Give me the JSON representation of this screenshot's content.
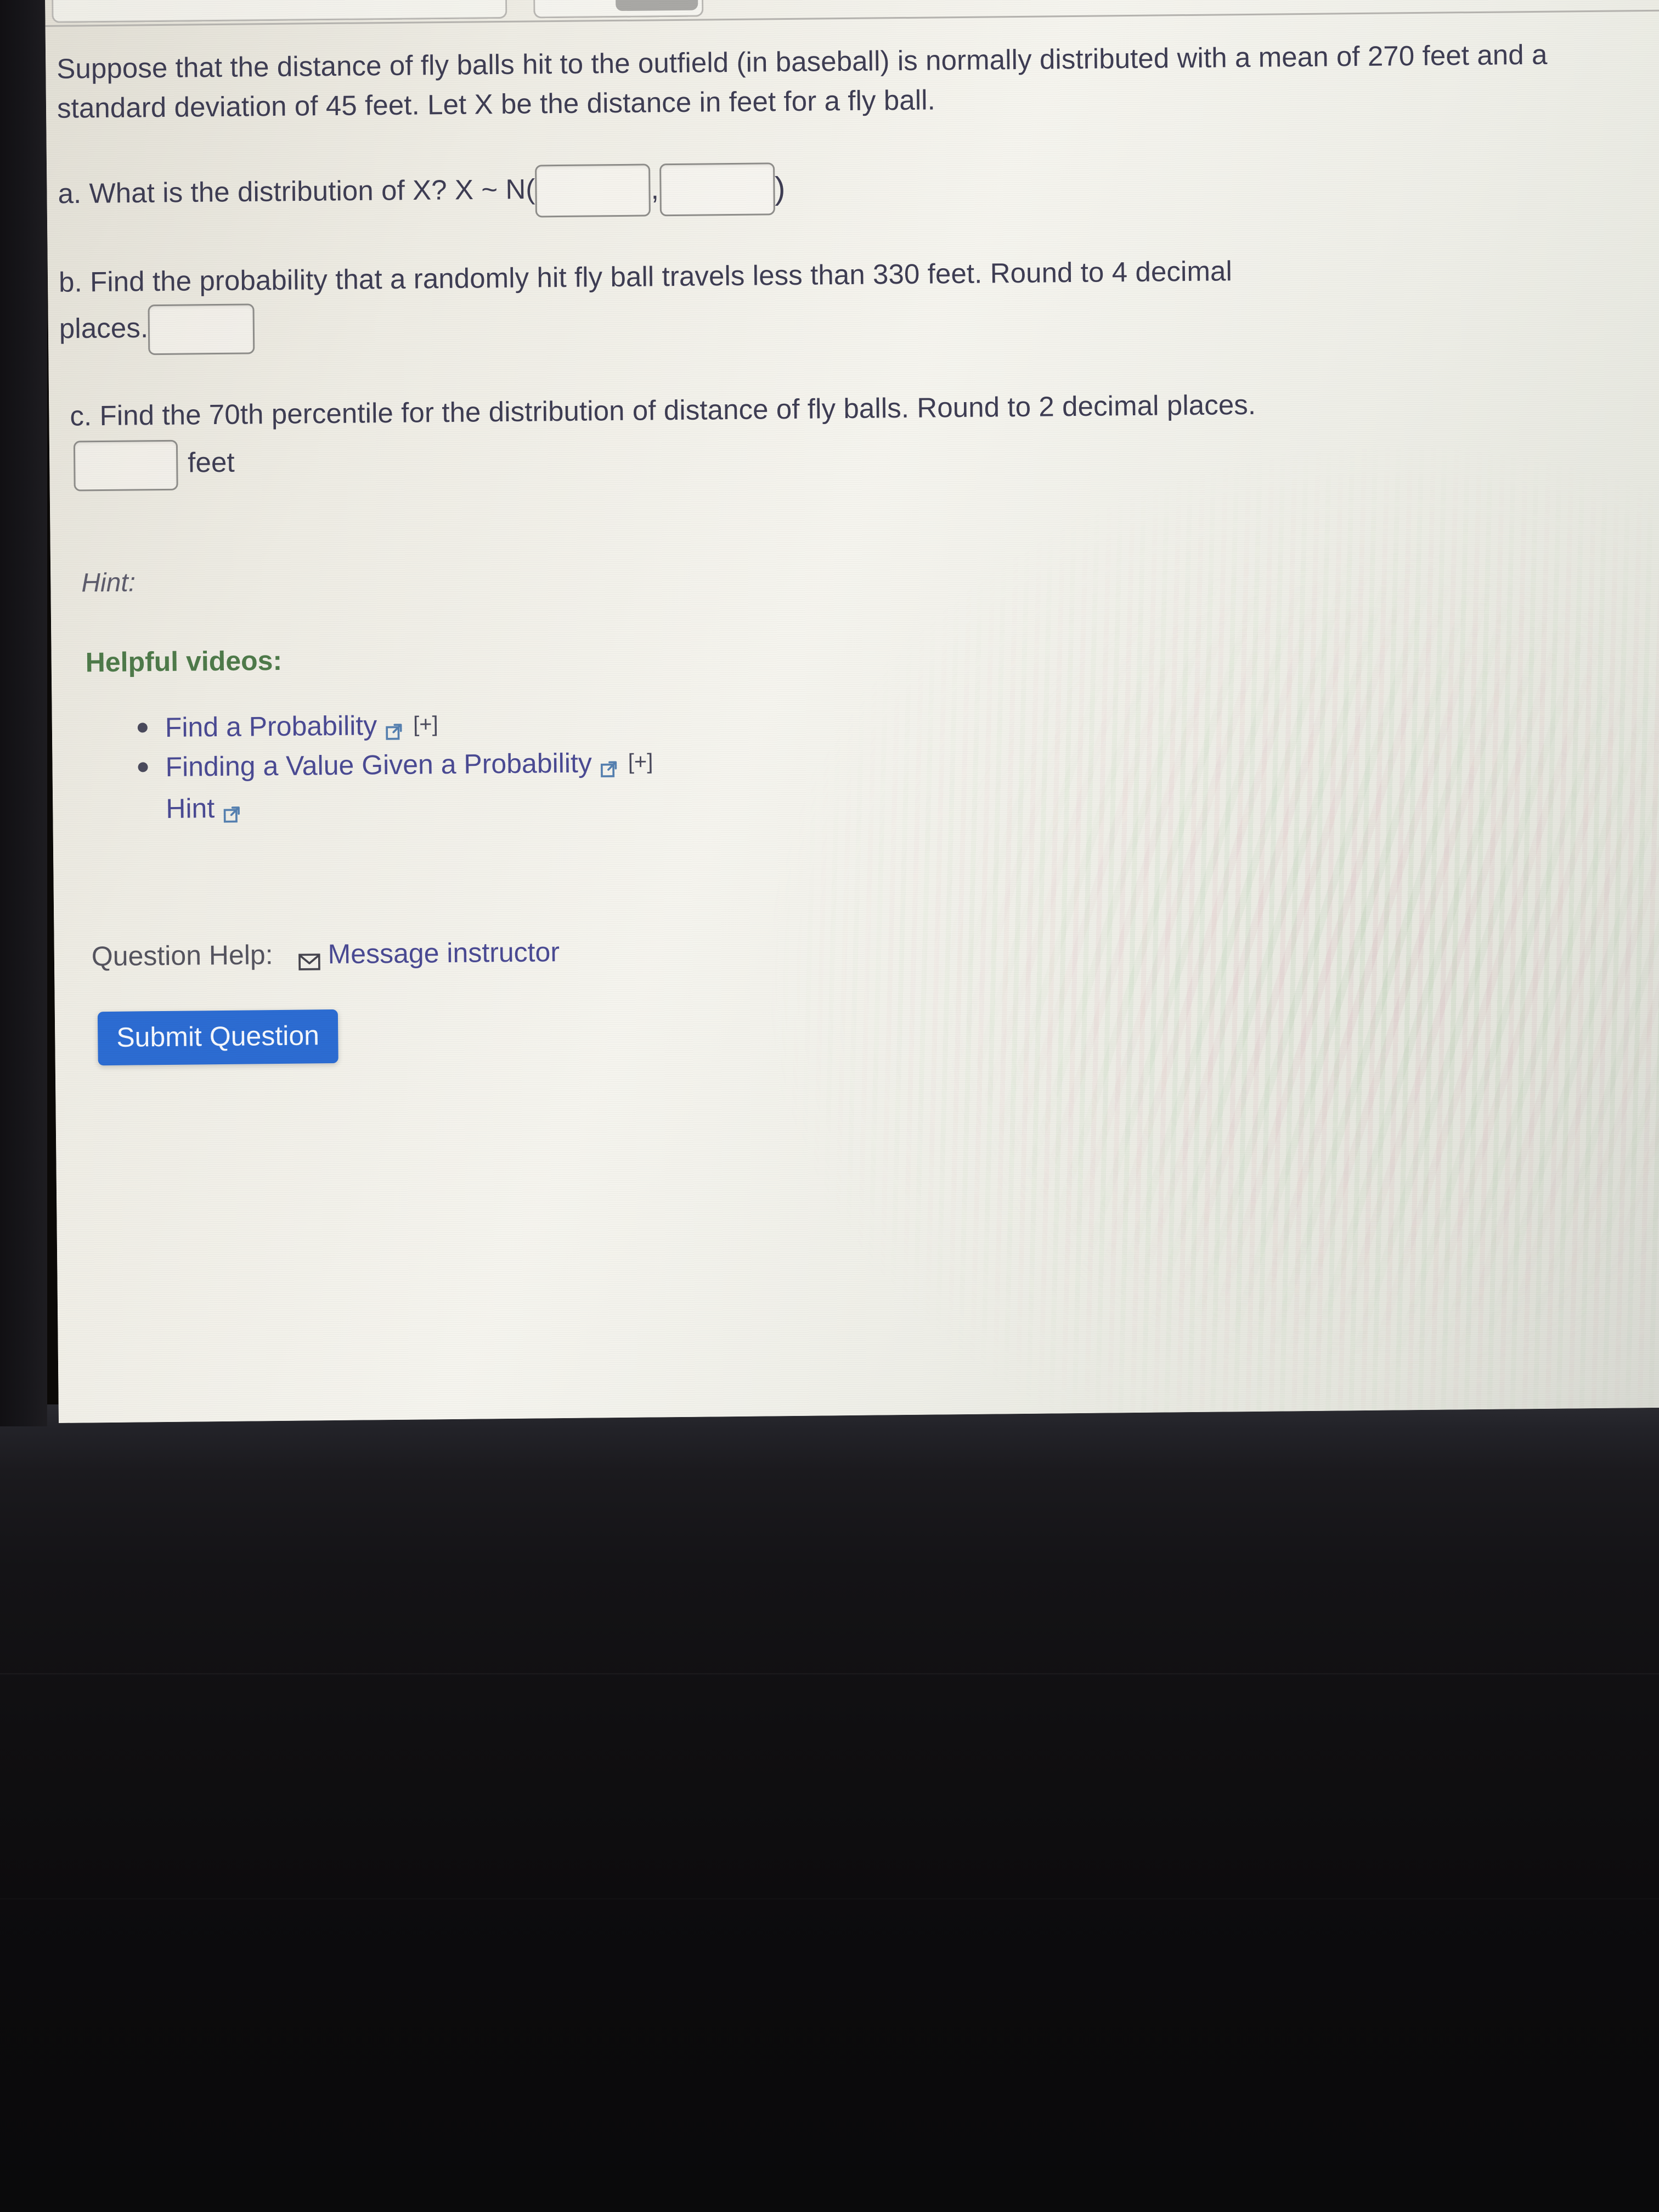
{
  "question": {
    "prompt": "Suppose that the distance of fly balls hit to the outfield (in baseball) is normally distributed with a mean of 270 feet and a standard deviation of 45 feet. Let X be the distance in feet for a fly ball.",
    "part_a": {
      "label": "a. What is the distribution of X? X ~ N(",
      "close": ")",
      "comma": ",",
      "mean_value": "",
      "mean_placeholder": "",
      "sd_value": "",
      "sd_placeholder": ""
    },
    "part_b": {
      "line1": "b. Find the probability that a randomly hit fly ball travels less than 330 feet. Round to 4 decimal",
      "line2": "places.",
      "answer_value": "",
      "answer_placeholder": ""
    },
    "part_c": {
      "line1": "c. Find the 70th percentile for the distribution of distance of fly balls. Round to 2 decimal places.",
      "unit": "feet",
      "answer_value": "",
      "answer_placeholder": ""
    }
  },
  "hint": {
    "label": "Hint:",
    "videos_heading": "Helpful videos:",
    "videos": [
      {
        "label": "Find a Probability",
        "icon": "external-link-icon",
        "expander": "[+]"
      },
      {
        "label": "Finding a Value Given a Probability",
        "icon": "external-link-icon",
        "expander": "[+]"
      }
    ],
    "hint_link": {
      "label": "Hint",
      "icon": "external-link-icon"
    }
  },
  "question_help": {
    "label": "Question Help:",
    "message_icon": "envelope-icon",
    "message_label": "Message instructor"
  },
  "submit": {
    "label": "Submit Question"
  },
  "colors": {
    "body_text": "#3e3d53",
    "link": "#4a4a93",
    "green_heading": "#4e7a4a",
    "submit_bg": "#2c6cd2",
    "icon_blue": "#5580b0",
    "page_bg": "#eceae3"
  }
}
